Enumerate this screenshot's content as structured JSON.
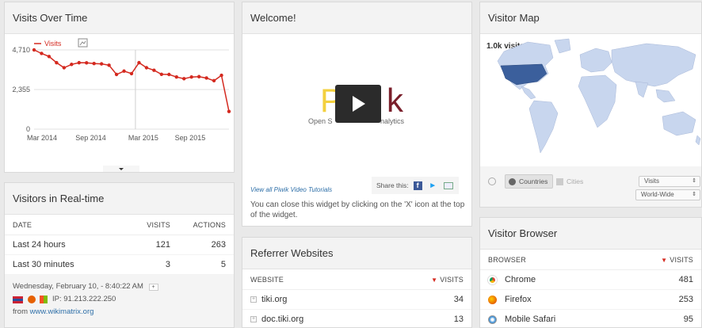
{
  "visits_widget": {
    "title": "Visits Over Time",
    "legend_label": "Visits",
    "chart_data": {
      "type": "line",
      "series": [
        {
          "name": "Visits",
          "values": [
            4710,
            4500,
            4320,
            3950,
            3650,
            3850,
            3950,
            3940,
            3900,
            3880,
            3800,
            3250,
            3450,
            3300,
            3950,
            3650,
            3500,
            3260,
            3250,
            3100,
            3000,
            3100,
            3120,
            3040,
            2880,
            3200,
            1050
          ]
        }
      ],
      "x": [
        0,
        1,
        2,
        3,
        4,
        5,
        6,
        7,
        8,
        9,
        10,
        11,
        12,
        13,
        14,
        15,
        16,
        17,
        18,
        19,
        20,
        21,
        22,
        23,
        24,
        25,
        26
      ],
      "x_tick_labels": [
        "Mar 2014",
        "Sep 2014",
        "Mar 2015",
        "Sep 2015"
      ],
      "y_tick_labels": [
        "4,710",
        "2,355",
        "0"
      ],
      "ylim": [
        0,
        4710
      ],
      "color": "#d4291f"
    }
  },
  "realtime_widget": {
    "title": "Visitors in Real-time",
    "columns": [
      "DATE",
      "VISITS",
      "ACTIONS"
    ],
    "rows": [
      {
        "label": "Last 24 hours",
        "visits": "121",
        "actions": "263"
      },
      {
        "label": "Last 30 minutes",
        "visits": "3",
        "actions": "5"
      }
    ],
    "last_visit_time": "Wednesday, February 10, - 8:40:22 AM",
    "ip": "IP: 91.213.222.250",
    "from_label": "from",
    "from_link": "www.wikimatrix.org"
  },
  "welcome_widget": {
    "title": "Welcome!",
    "video_logo_left": "P",
    "video_logo_right": "k",
    "video_subtitle_left": "Open S",
    "video_subtitle_right": "nalytics",
    "tutorials_link": "View all Piwik Video Tutorials",
    "share_label": "Share this:",
    "close_hint": "You can close this widget by clicking on the 'X' icon at the top of the widget."
  },
  "referrer_widget": {
    "title": "Referrer Websites",
    "columns": [
      "WEBSITE",
      "VISITS"
    ],
    "rows": [
      {
        "label": "tiki.org",
        "visits": "34"
      },
      {
        "label": "doc.tiki.org",
        "visits": "13"
      }
    ]
  },
  "map_widget": {
    "title": "Visitor Map",
    "top_label": "1.0k visits",
    "tab_countries": "Countries",
    "tab_cities": "Cities",
    "metric_select": "Visits",
    "region_select": "World-Wide",
    "colors": {
      "ocean": "#ffffff",
      "land": "#c8d6ee",
      "highlight": "#3b5f9c"
    }
  },
  "browser_widget": {
    "title": "Visitor Browser",
    "columns": [
      "BROWSER",
      "VISITS"
    ],
    "rows": [
      {
        "label": "Chrome",
        "visits": "481",
        "icon": "chrome-icon"
      },
      {
        "label": "Firefox",
        "visits": "253",
        "icon": "firefox-icon"
      },
      {
        "label": "Mobile Safari",
        "visits": "95",
        "icon": "safari-icon"
      }
    ]
  }
}
